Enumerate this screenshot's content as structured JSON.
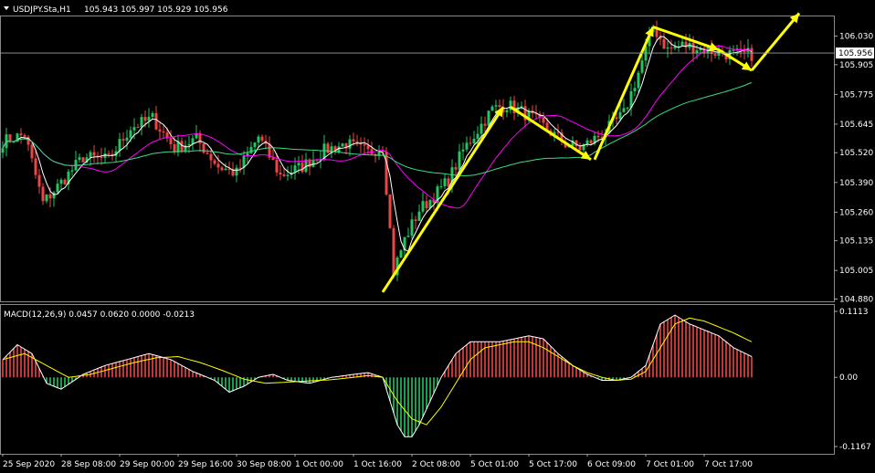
{
  "header": {
    "title": "USDJPY.Sta,H1",
    "ohlc": "105.943 105.997 105.929 105.956",
    "macd_label": "MACD(12,26,9) 0.0457 0.0620 0.0000 -0.0213"
  },
  "colors": {
    "background": "#000000",
    "bull": "#22c55e",
    "bear": "#ef4444",
    "ma_fast": "#ffffff",
    "ma_mid": "#ff00ff",
    "ma_slow": "#3ddc84",
    "arrow": "#ffff00",
    "macd_line": "#ffffff",
    "signal_line": "#ffff00",
    "hist_pos": "#ef4444",
    "hist_neg": "#22c55e"
  },
  "chart_data": {
    "type": "line",
    "title": "USDJPY.Sta,H1",
    "price_axis": {
      "ticks": [
        "106.030",
        "105.905",
        "105.775",
        "105.645",
        "105.520",
        "105.390",
        "105.260",
        "105.135",
        "105.005",
        "104.880"
      ],
      "current": "105.956",
      "range": [
        104.87,
        106.12
      ]
    },
    "macd_axis": {
      "ticks": [
        "0.1113",
        "0.00",
        "-0.1167"
      ],
      "range": [
        -0.1167,
        0.1113
      ]
    },
    "time_labels": [
      "25 Sep 2020",
      "28 Sep 08:00",
      "29 Sep 00:00",
      "29 Sep 16:00",
      "30 Sep 08:00",
      "1 Oct 00:00",
      "1 Oct 16:00",
      "2 Oct 08:00",
      "5 Oct 01:00",
      "5 Oct 17:00",
      "6 Oct 09:00",
      "7 Oct 01:00",
      "7 Oct 17:00"
    ],
    "time_label_bar_index": [
      0,
      16,
      32,
      48,
      64,
      80,
      96,
      112,
      128,
      144,
      160,
      176,
      192
    ],
    "close_series": {
      "name": "",
      "x_bar_index": [
        0,
        6,
        11,
        16,
        22,
        29,
        35,
        41,
        47,
        53,
        59,
        64,
        70,
        76,
        82,
        88,
        94,
        100,
        104,
        107,
        110,
        114,
        118,
        122,
        126,
        130,
        134,
        138,
        142,
        146,
        150,
        154,
        158,
        162,
        166,
        170,
        174,
        178,
        182,
        186,
        190,
        195,
        200,
        205
      ],
      "values": [
        105.57,
        105.6,
        105.3,
        105.39,
        105.5,
        105.49,
        105.63,
        105.67,
        105.54,
        105.58,
        105.46,
        105.43,
        105.59,
        105.42,
        105.46,
        105.53,
        105.56,
        105.52,
        105.55,
        105.0,
        105.14,
        105.27,
        105.33,
        105.4,
        105.53,
        105.62,
        105.71,
        105.73,
        105.7,
        105.66,
        105.61,
        105.56,
        105.54,
        105.58,
        105.63,
        105.69,
        105.87,
        106.07,
        105.97,
        105.99,
        105.98,
        105.96,
        105.95,
        105.95
      ]
    },
    "macd_series": {
      "name": "",
      "x_bar_index": [
        0,
        4,
        8,
        12,
        16,
        22,
        28,
        34,
        40,
        46,
        52,
        58,
        62,
        66,
        70,
        74,
        78,
        84,
        90,
        96,
        100,
        104,
        106,
        108,
        110,
        112,
        114,
        117,
        120,
        124,
        128,
        132,
        136,
        140,
        144,
        148,
        152,
        156,
        160,
        164,
        168,
        172,
        176,
        180,
        184,
        188,
        192,
        196,
        200,
        205
      ],
      "values": [
        0.03,
        0.055,
        0.04,
        -0.01,
        -0.02,
        0.005,
        0.02,
        0.03,
        0.04,
        0.03,
        0.01,
        -0.005,
        -0.025,
        -0.015,
        0.0,
        0.005,
        -0.005,
        -0.01,
        0.0,
        0.005,
        0.008,
        0.0,
        -0.04,
        -0.08,
        -0.1,
        -0.1,
        -0.08,
        -0.04,
        0.0,
        0.04,
        0.06,
        0.06,
        0.06,
        0.065,
        0.07,
        0.065,
        0.04,
        0.02,
        0.005,
        -0.005,
        -0.005,
        0.0,
        0.02,
        0.09,
        0.105,
        0.09,
        0.08,
        0.07,
        0.05,
        0.035
      ]
    },
    "signal_series": {
      "name": "",
      "x_bar_index": [
        0,
        6,
        12,
        18,
        24,
        30,
        36,
        42,
        48,
        54,
        60,
        66,
        72,
        78,
        84,
        90,
        96,
        100,
        104,
        108,
        112,
        116,
        120,
        124,
        128,
        132,
        136,
        140,
        144,
        148,
        152,
        156,
        160,
        164,
        168,
        172,
        176,
        180,
        184,
        188,
        192,
        196,
        200,
        205
      ],
      "values": [
        0.03,
        0.04,
        0.02,
        0.0,
        0.005,
        0.015,
        0.025,
        0.033,
        0.035,
        0.025,
        0.012,
        -0.003,
        -0.01,
        -0.008,
        -0.006,
        -0.004,
        0.0,
        0.003,
        0.0,
        -0.04,
        -0.07,
        -0.08,
        -0.05,
        -0.01,
        0.03,
        0.05,
        0.055,
        0.06,
        0.06,
        0.05,
        0.035,
        0.02,
        0.008,
        0.0,
        -0.005,
        -0.003,
        0.01,
        0.05,
        0.09,
        0.1,
        0.095,
        0.085,
        0.075,
        0.06
      ]
    },
    "annotations": {
      "arrows": [
        {
          "from": [
            104,
            104.91
          ],
          "to": [
            137,
            105.72
          ]
        },
        {
          "from": [
            139,
            105.72
          ],
          "to": [
            161,
            105.49
          ]
        },
        {
          "from": [
            162,
            105.49
          ],
          "to": [
            178,
            106.07
          ]
        },
        {
          "from": [
            178,
            106.07
          ],
          "to": [
            196,
            105.97
          ]
        },
        {
          "from": [
            196,
            105.97
          ],
          "to": [
            205,
            105.88
          ]
        },
        {
          "from": [
            205,
            105.88
          ],
          "to": [
            218,
            106.13
          ]
        }
      ]
    }
  }
}
